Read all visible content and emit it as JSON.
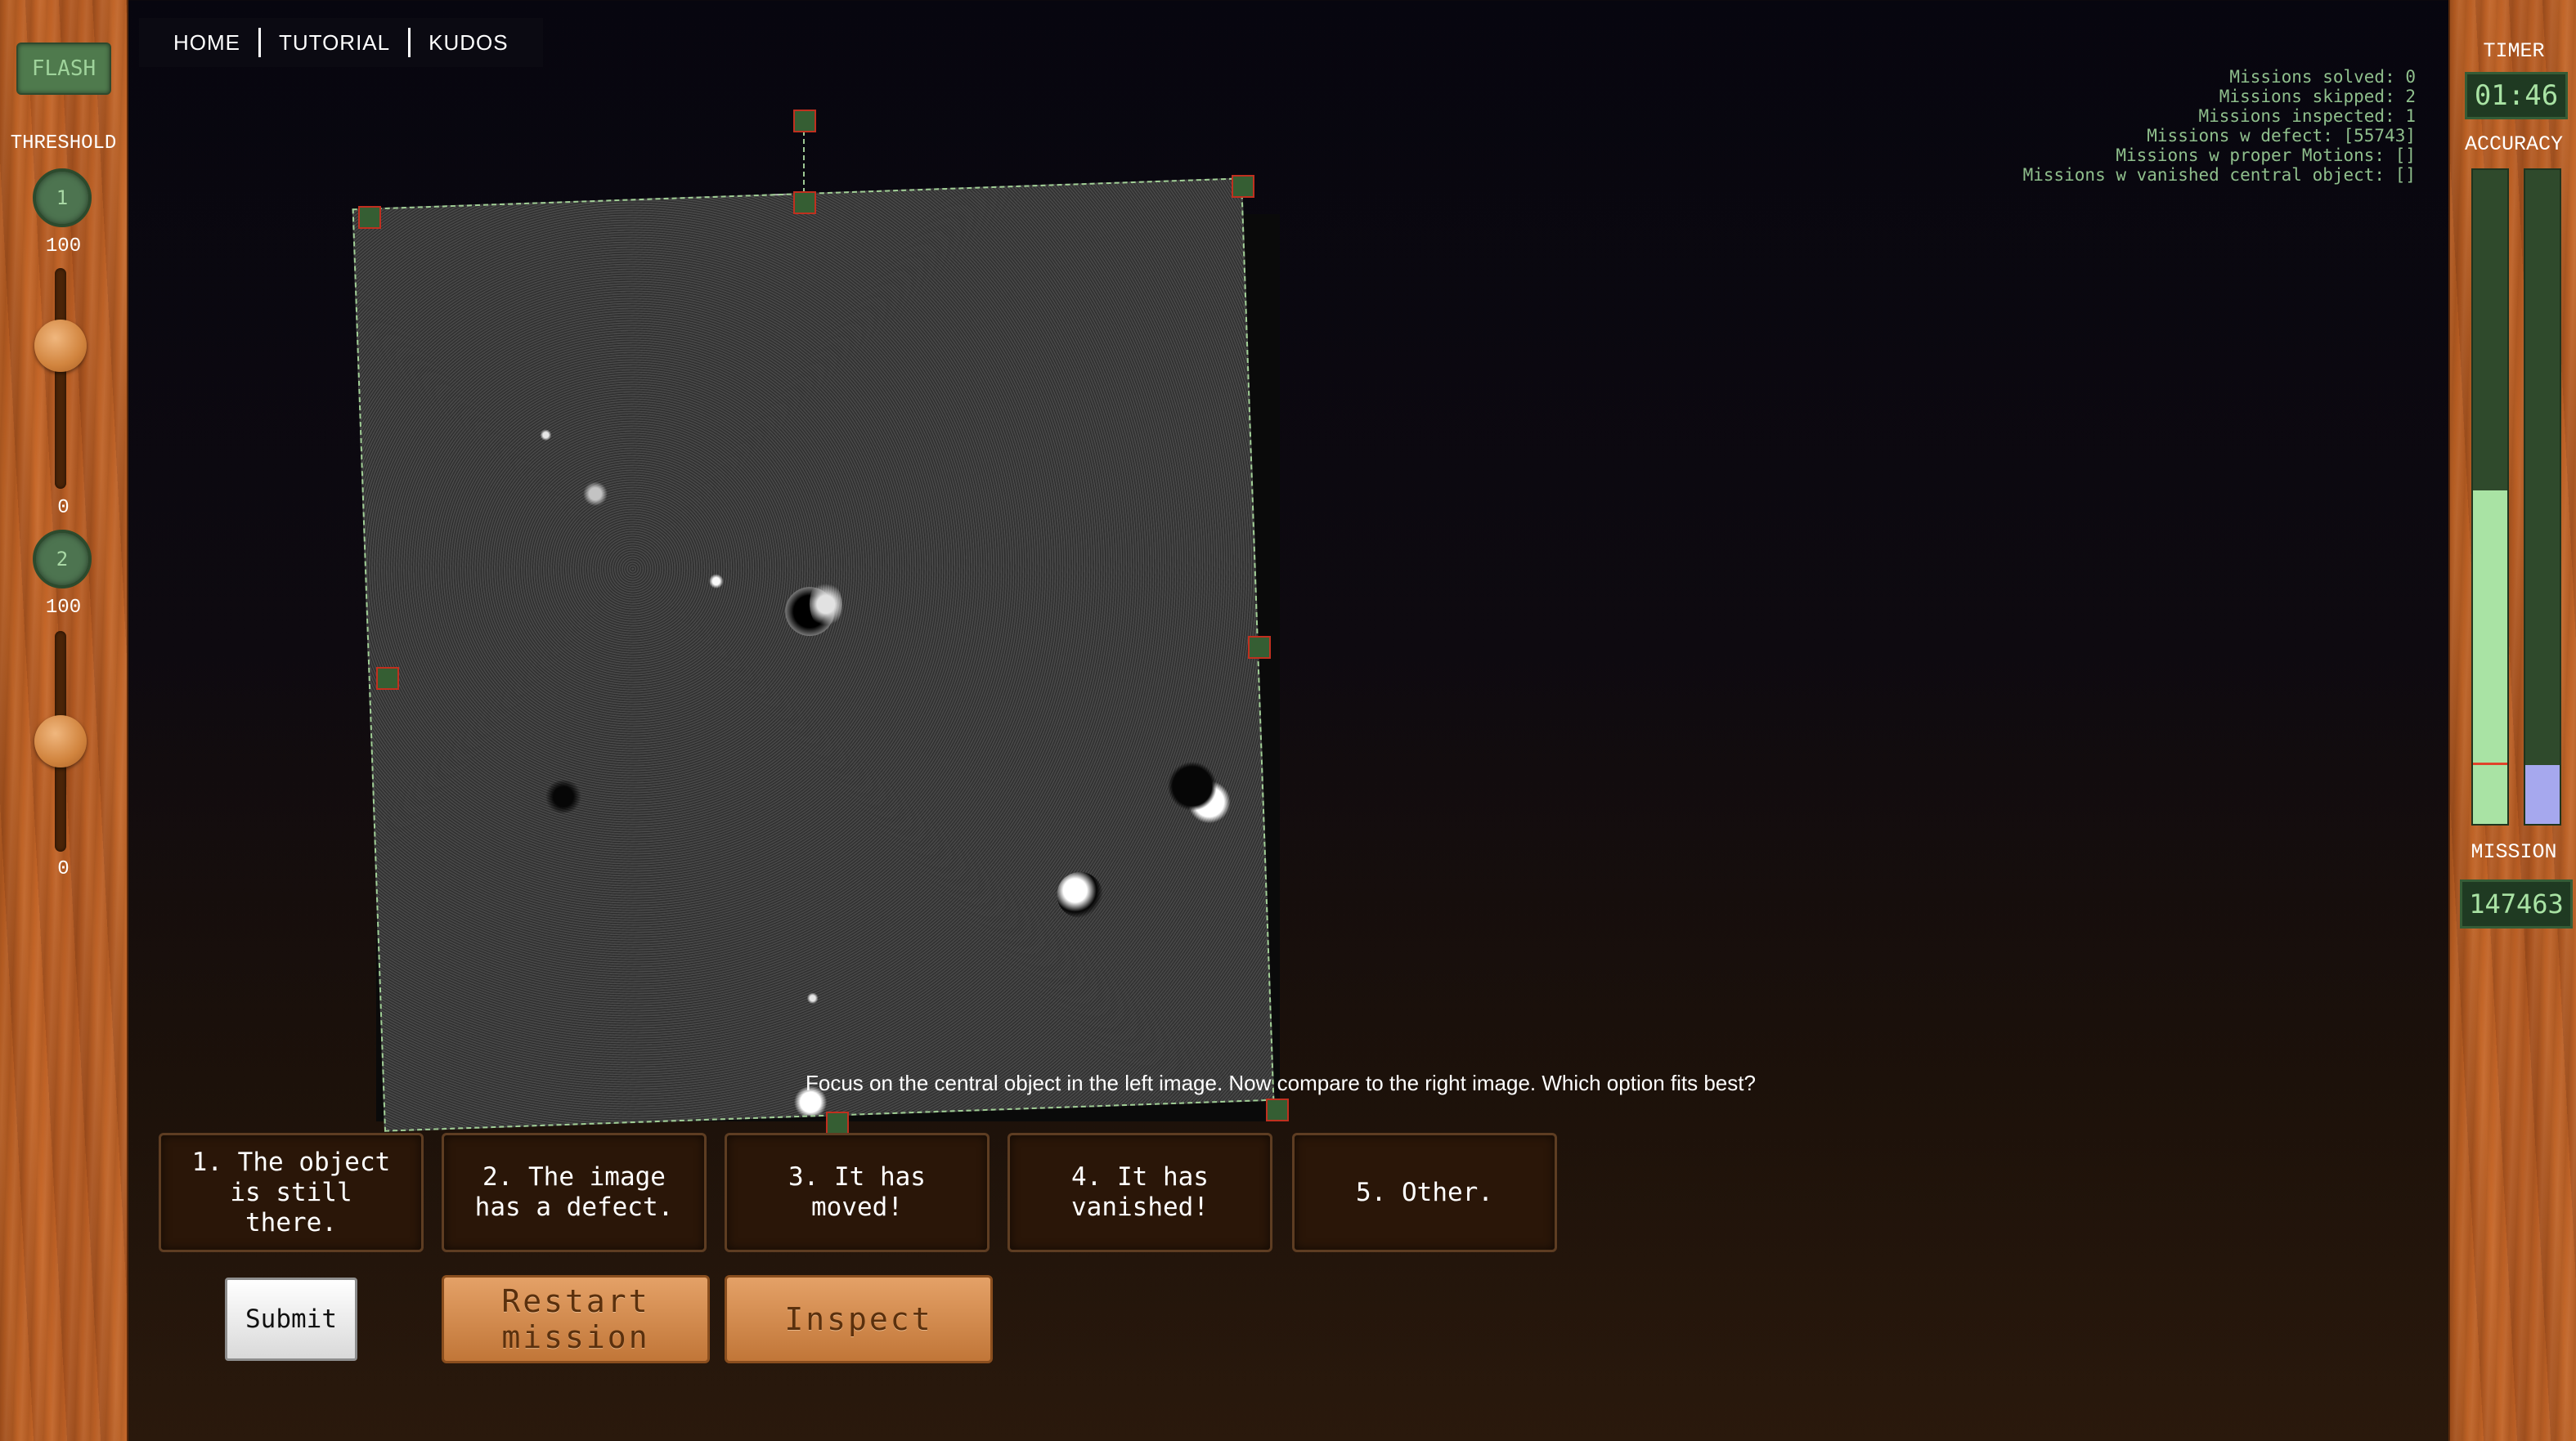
{
  "left_panel": {
    "flash_label": "FLASH",
    "threshold_label": "THRESHOLD",
    "threshold1": {
      "number": "1",
      "max": "100",
      "min": "0",
      "value": 0.65
    },
    "threshold2": {
      "number": "2",
      "max": "100",
      "min": "0",
      "value": 0.5
    }
  },
  "nav": {
    "home": "HOME",
    "tutorial": "TUTORIAL",
    "kudos": "KUDOS"
  },
  "stats": {
    "solved": "Missions solved: 0",
    "skipped": "Missions skipped: 2",
    "inspected": "Missions inspected: 1",
    "defect": "Missions w defect: [55743]",
    "proper_motions": "Missions w proper Motions: []",
    "vanished": "Missions w vanished central object: []"
  },
  "right_panel": {
    "timer_label": "TIMER",
    "timer_value": "01:46",
    "accuracy_label": "ACCURACY",
    "accuracy_bar1": {
      "fill": 0.51,
      "color": "#a9e3a4",
      "marker": 0.09,
      "marker_color": "#e0432a"
    },
    "accuracy_bar2": {
      "fill": 0.09,
      "color": "#a6a8ee"
    },
    "mission_label": "MISSION",
    "mission_value": "147463"
  },
  "prompt": "Focus on the central object in the left image. Now compare to the right image. Which option fits best?",
  "options": [
    {
      "label": "1. The object\nis still\nthere."
    },
    {
      "label": "2. The image\nhas a defect."
    },
    {
      "label": "3. It has\nmoved!"
    },
    {
      "label": "4. It has\nvanished!"
    },
    {
      "label": "5. Other."
    }
  ],
  "buttons": {
    "submit": "Submit",
    "restart": "Restart\nmission",
    "inspect": "Inspect"
  }
}
